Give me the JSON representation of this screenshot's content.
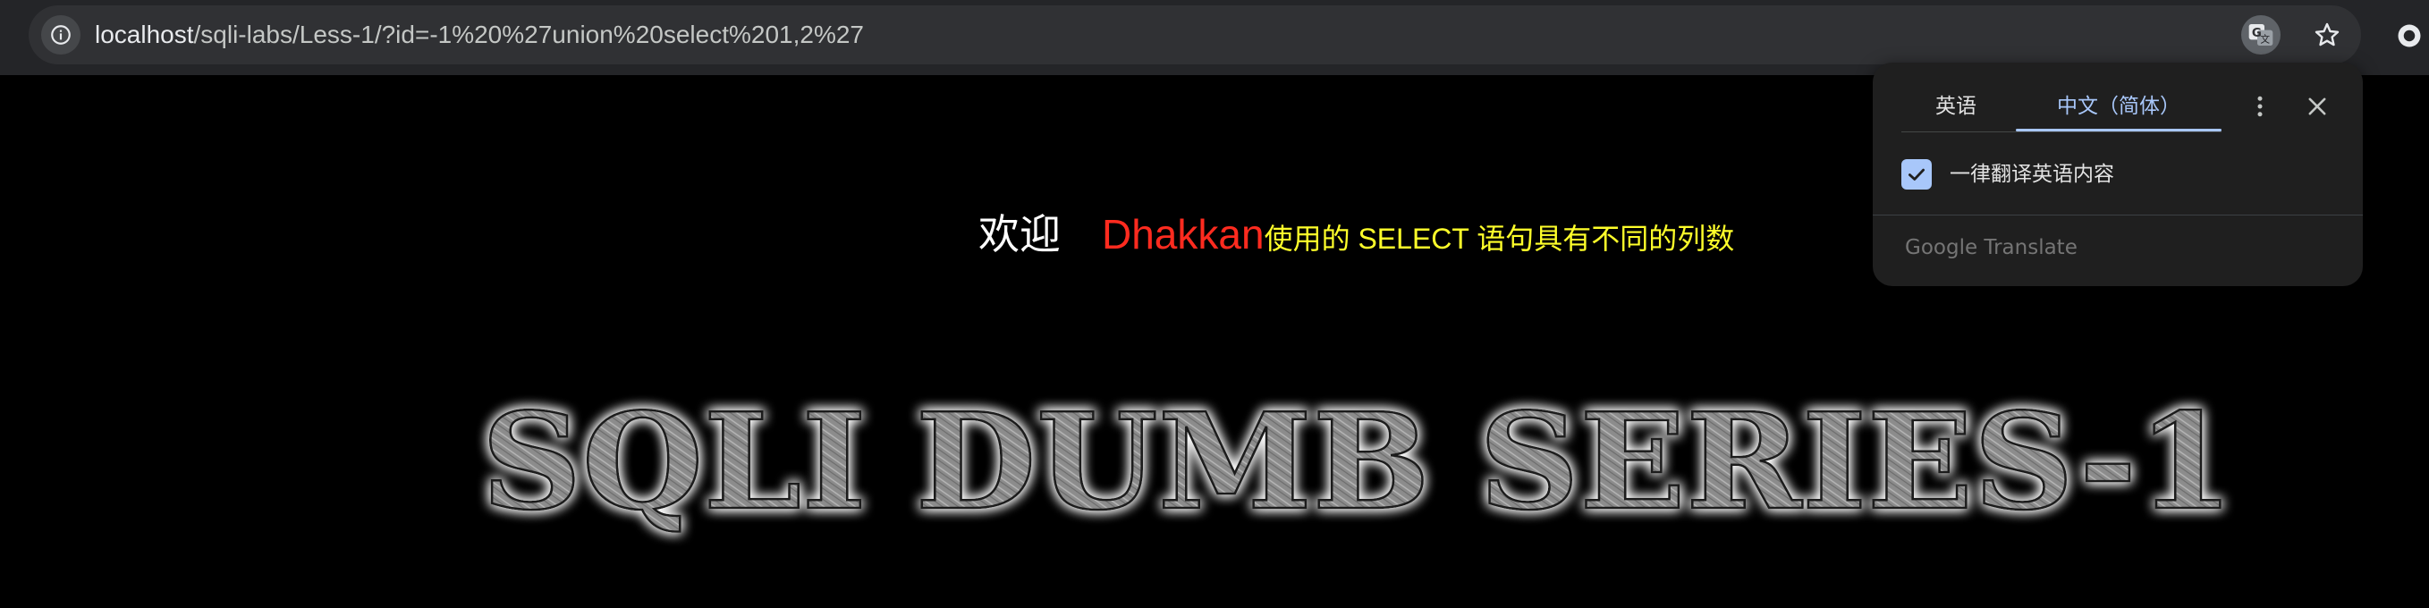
{
  "browser": {
    "url_host": "localhost",
    "url_path": "/sqli-labs/Less-1/?id=-1%20%27union%20select%201,2%27",
    "icons": {
      "site_info": "info-icon",
      "translate": "translate-icon",
      "bookmark": "star-icon",
      "extension": "extension-icon"
    }
  },
  "page": {
    "welcome": "欢迎",
    "name": "Dhakkan",
    "message": "使用的 SELECT 语句具有不同的列数",
    "banner": "SQLI DUMB SERIES-1",
    "colors": {
      "background": "#000000",
      "welcome": "#ffffff",
      "name": "#ff2b1f",
      "message": "#ffff2a"
    }
  },
  "translate_popup": {
    "tabs": [
      {
        "label": "英语",
        "selected": false
      },
      {
        "label": "中文（简体）",
        "selected": true
      }
    ],
    "always_translate": {
      "label": "一律翻译英语内容",
      "checked": true
    },
    "branding": "Google Translate",
    "icons": {
      "menu": "more-vert-icon",
      "close": "close-icon",
      "check": "check-icon"
    },
    "accent_color": "#a8c7fa"
  }
}
